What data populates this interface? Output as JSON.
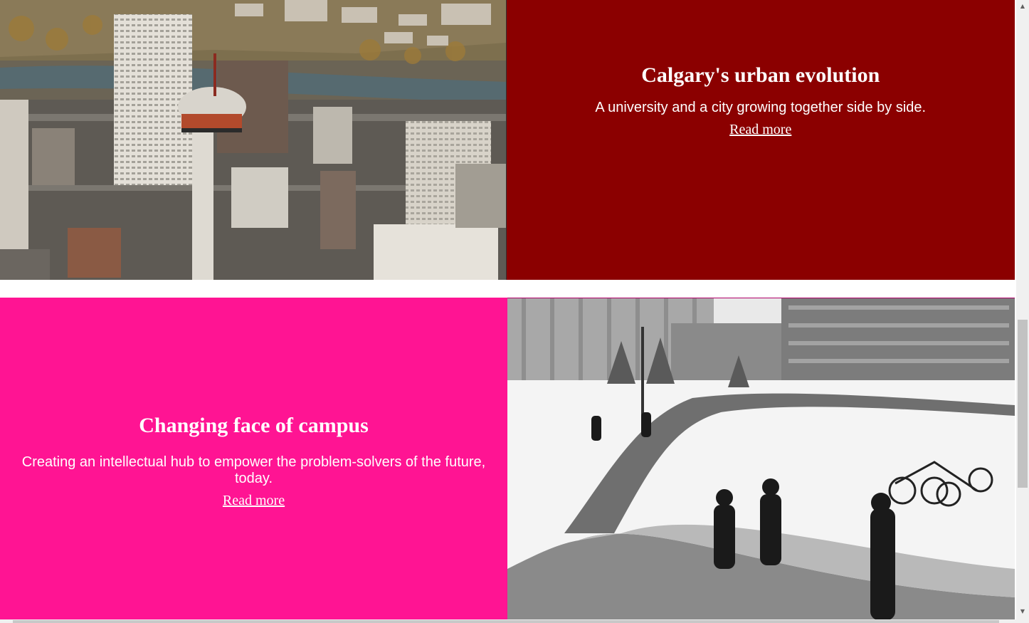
{
  "sections": [
    {
      "title": "Calgary's urban evolution",
      "description": "A university and a city growing together side by side.",
      "link_label": "Read more",
      "background": "#8b0000",
      "image": "aerial-city-photo"
    },
    {
      "title": "Changing face of campus",
      "description": "Creating an intellectual hub to empower the problem-solvers of the future, today.",
      "link_label": "Read more",
      "background": "#ff1493",
      "image": "winter-campus-photo"
    }
  ],
  "scrollbar": {
    "up_icon": "arrow-up-icon",
    "down_icon": "arrow-down-icon"
  }
}
